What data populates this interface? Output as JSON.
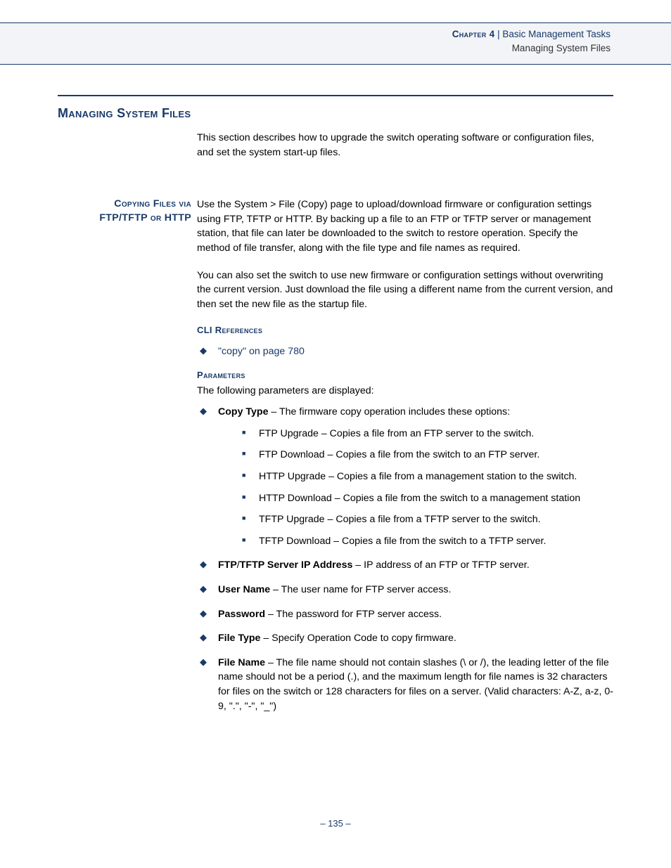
{
  "header": {
    "chapter_label": "Chapter 4",
    "separator": "  |  ",
    "breadcrumb": "Basic Management Tasks",
    "subtitle": "Managing System Files"
  },
  "title": "Managing System Files",
  "intro_para": "This section describes how to upgrade the switch operating software or configuration files, and set the system start-up files.",
  "section": {
    "side_heading_line1": "Copying Files via",
    "side_heading_line2": "FTP/TFTP or HTTP",
    "para1": "Use the System > File (Copy) page to upload/download firmware or configuration settings using FTP, TFTP or HTTP. By backing up a file to an FTP or TFTP server or management station, that file can later be downloaded to the switch to restore operation. Specify the method of file transfer, along with the file type and file names as required.",
    "para2": "You can also set the switch to use new firmware or configuration settings without overwriting the current version. Just download the file using a different name from the current version, and then set the new file as the startup file.",
    "cli_heading": "CLI References",
    "cli_link": "\"copy\" on page 780",
    "params_heading": "Parameters",
    "params_intro": "The following parameters are displayed:",
    "params": [
      {
        "label": "Copy Type",
        "desc": " – The firmware copy operation includes these options:",
        "sub": [
          "FTP Upgrade – Copies a file from an FTP server to the switch.",
          "FTP Download – Copies a file from the switch to an FTP server.",
          "HTTP Upgrade – Copies a file from a management station to the switch.",
          "HTTP Download – Copies a file from the switch to a management station",
          "TFTP Upgrade – Copies a file from a TFTP server to the switch.",
          "TFTP Download – Copies a file from the switch to a TFTP server."
        ]
      },
      {
        "label": "FTP",
        "label2_sep": "/",
        "label2": "TFTP Server IP Address",
        "desc": " – IP address of an FTP or TFTP server."
      },
      {
        "label": "User Name",
        "desc": " – The user name for FTP server access."
      },
      {
        "label": "Password",
        "desc": " – The password for FTP server access."
      },
      {
        "label": "File Type",
        "desc": " – Specify Operation Code to copy firmware."
      },
      {
        "label": "File Name",
        "desc": " – The file name should not contain slashes (\\ or /), the leading letter of the file name should not be a period (.), and the maximum length for file names is 32 characters for files on the switch or 128 characters for files on a server. (Valid characters: A-Z, a-z, 0-9, \".\", \"-\", \"_\")"
      }
    ]
  },
  "page_number": "–  135  –"
}
